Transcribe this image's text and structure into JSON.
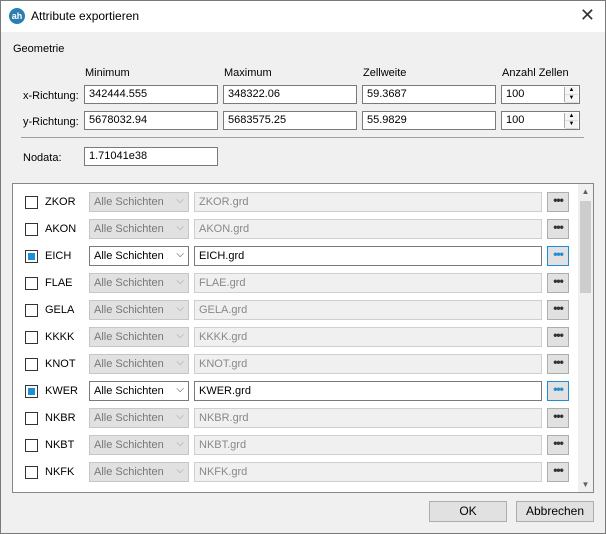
{
  "window": {
    "title": "Attribute exportieren",
    "icon": "app-logo-icon",
    "close": "✕"
  },
  "geometry": {
    "section_label": "Geometrie",
    "headers": {
      "minimum": "Minimum",
      "maximum": "Maximum",
      "cellsize": "Zellweite",
      "cellcount": "Anzahl Zellen"
    },
    "x": {
      "label": "x-Richtung:",
      "min": "342444.555",
      "max": "348322.06",
      "cell": "59.3687",
      "count": "100"
    },
    "y": {
      "label": "y-Richtung:",
      "min": "5678032.94",
      "max": "5683575.25",
      "cell": "55.9829",
      "count": "100"
    },
    "nodata": {
      "label": "Nodata:",
      "value": "1.71041e38"
    }
  },
  "layers": [
    {
      "code": "ZKOR",
      "source": "Alle Schichten",
      "file": "ZKOR.grd",
      "checked": false
    },
    {
      "code": "AKON",
      "source": "Alle Schichten",
      "file": "AKON.grd",
      "checked": false
    },
    {
      "code": "EICH",
      "source": "Alle Schichten",
      "file": "EICH.grd",
      "checked": true
    },
    {
      "code": "FLAE",
      "source": "Alle Schichten",
      "file": "FLAE.grd",
      "checked": false
    },
    {
      "code": "GELA",
      "source": "Alle Schichten",
      "file": "GELA.grd",
      "checked": false
    },
    {
      "code": "KKKK",
      "source": "Alle Schichten",
      "file": "KKKK.grd",
      "checked": false
    },
    {
      "code": "KNOT",
      "source": "Alle Schichten",
      "file": "KNOT.grd",
      "checked": false
    },
    {
      "code": "KWER",
      "source": "Alle Schichten",
      "file": "KWER.grd",
      "checked": true
    },
    {
      "code": "NKBR",
      "source": "Alle Schichten",
      "file": "NKBR.grd",
      "checked": false
    },
    {
      "code": "NKBT",
      "source": "Alle Schichten",
      "file": "NKBT.grd",
      "checked": false
    },
    {
      "code": "NKFK",
      "source": "Alle Schichten",
      "file": "NKFK.grd",
      "checked": false
    }
  ],
  "browse_label": "•••",
  "buttons": {
    "ok": "OK",
    "cancel": "Abbrechen"
  },
  "colors": {
    "accent": "#1f8dd6"
  }
}
